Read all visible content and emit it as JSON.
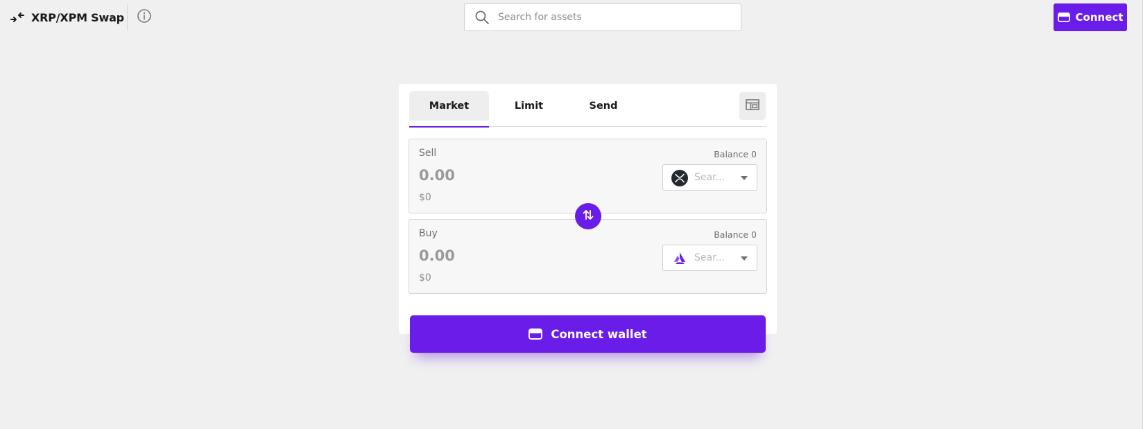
{
  "header": {
    "brand_title": "XRP/XPM Swap",
    "brand_icon": "swap-arrows-icon",
    "info_icon": "info-icon",
    "search": {
      "placeholder": "Search for assets",
      "value": "",
      "icon": "search-icon"
    },
    "connect_label": "Connect",
    "connect_icon": "wallet-icon"
  },
  "swap": {
    "tabs": [
      {
        "label": "Market",
        "active": true
      },
      {
        "label": "Limit",
        "active": false
      },
      {
        "label": "Send",
        "active": false
      }
    ],
    "layout_icon": "layout-icon",
    "sell": {
      "label": "Sell",
      "balance": "Balance 0",
      "amount_placeholder": "0.00",
      "usd_value": "$0",
      "asset_placeholder": "Sear...",
      "token_icon": "xrp-icon"
    },
    "buy": {
      "label": "Buy",
      "balance": "Balance 0",
      "amount_placeholder": "0.00",
      "usd_value": "$0",
      "asset_placeholder": "Sear...",
      "token_icon": "xpm-icon"
    },
    "swap_direction_icon": "swap-vertical-icon",
    "connect_wallet_label": "Connect wallet"
  },
  "colors": {
    "accent": "#6a1de8",
    "background": "#f0f0f0",
    "card": "#ffffff"
  }
}
